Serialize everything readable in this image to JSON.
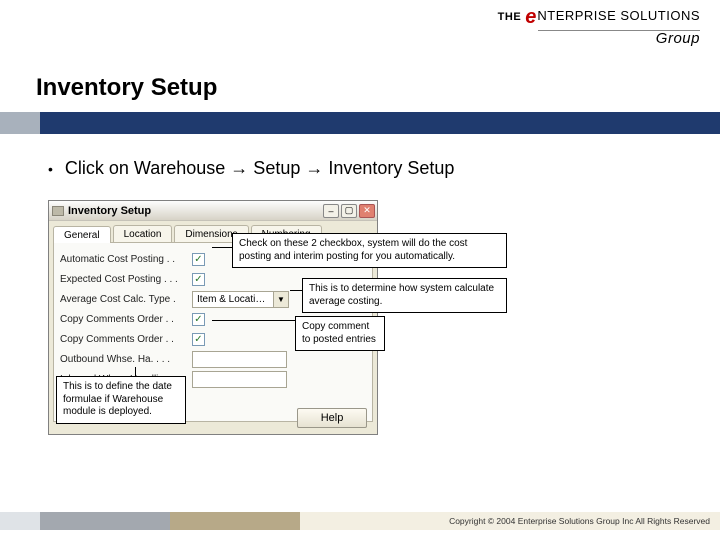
{
  "brand": {
    "prefix": "THE",
    "e": "e",
    "rest": "NTERPRISE SOLUTIONS",
    "sub": "Group"
  },
  "slide": {
    "title": "Inventory Setup",
    "bullet": "Click on Warehouse → Setup → Inventory Setup"
  },
  "window": {
    "title": "Inventory Setup",
    "tabs": [
      "General",
      "Location",
      "Dimensions",
      "Numbering"
    ],
    "fields": {
      "auto_cost_posting": "Automatic Cost Posting . .",
      "expected_cost_posting": "Expected Cost Posting . . .",
      "avg_cost_calc_type": "Average Cost Calc. Type .",
      "avg_cost_value": "Item & Locati…",
      "copy_comments_order1": "Copy Comments Order . .",
      "copy_comments_order2": "Copy Comments Order . .",
      "outbound_whse": "Outbound Whse. Ha. . . .",
      "inbound_whse": "Inbound Whse. Handli. . ."
    },
    "help": "Help"
  },
  "callouts": {
    "c1": "Check on these 2 checkbox, system will do the cost posting and interim posting for you automatically.",
    "c2": "This is to determine how system calculate average costing.",
    "c3": "Copy comment to posted entries",
    "c4": "This is to define the date formulae if Warehouse module is deployed."
  },
  "footer": {
    "copyright": "Copyright © 2004 Enterprise Solutions Group Inc All Rights Reserved"
  }
}
